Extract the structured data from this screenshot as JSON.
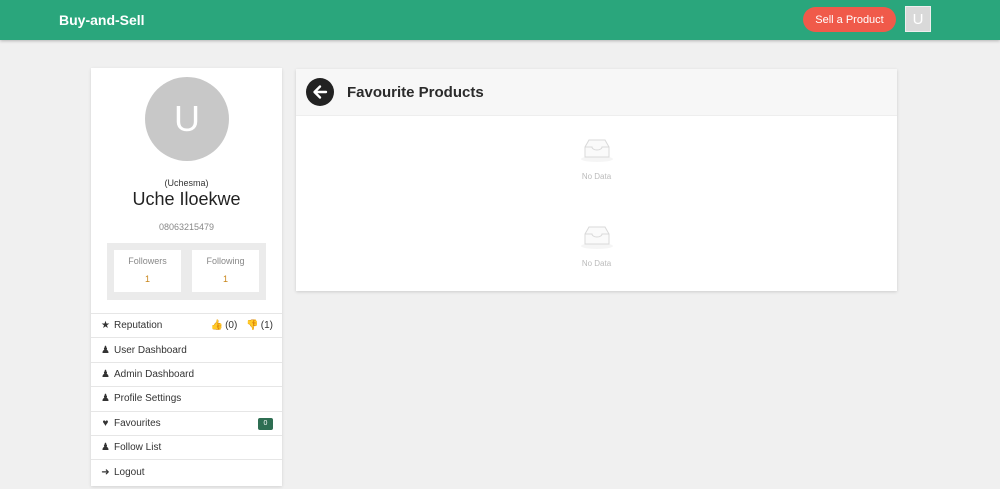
{
  "header": {
    "brand": "Buy-and-Sell",
    "sell_button": "Sell a Product",
    "user_initial": "U"
  },
  "profile": {
    "avatar_initial": "U",
    "username": "(Uchesma)",
    "full_name": "Uche Iloekwe",
    "phone": "08063215479",
    "followers_label": "Followers",
    "followers_count": "1",
    "following_label": "Following",
    "following_count": "1"
  },
  "menu": {
    "reputation": {
      "label": "Reputation",
      "up": "(0)",
      "down": "(1)"
    },
    "user_dashboard": "User Dashboard",
    "admin_dashboard": "Admin Dashboard",
    "profile_settings": "Profile Settings",
    "favourites": {
      "label": "Favourites",
      "badge": "0"
    },
    "follow_list": "Follow List",
    "logout": "Logout"
  },
  "favourites_panel": {
    "title": "Favourite Products",
    "empty_states": [
      "No Data",
      "No Data"
    ]
  },
  "colors": {
    "topbar": "#2aa67c",
    "sell_button": "#f05a4a",
    "badge": "#2e6e52"
  }
}
